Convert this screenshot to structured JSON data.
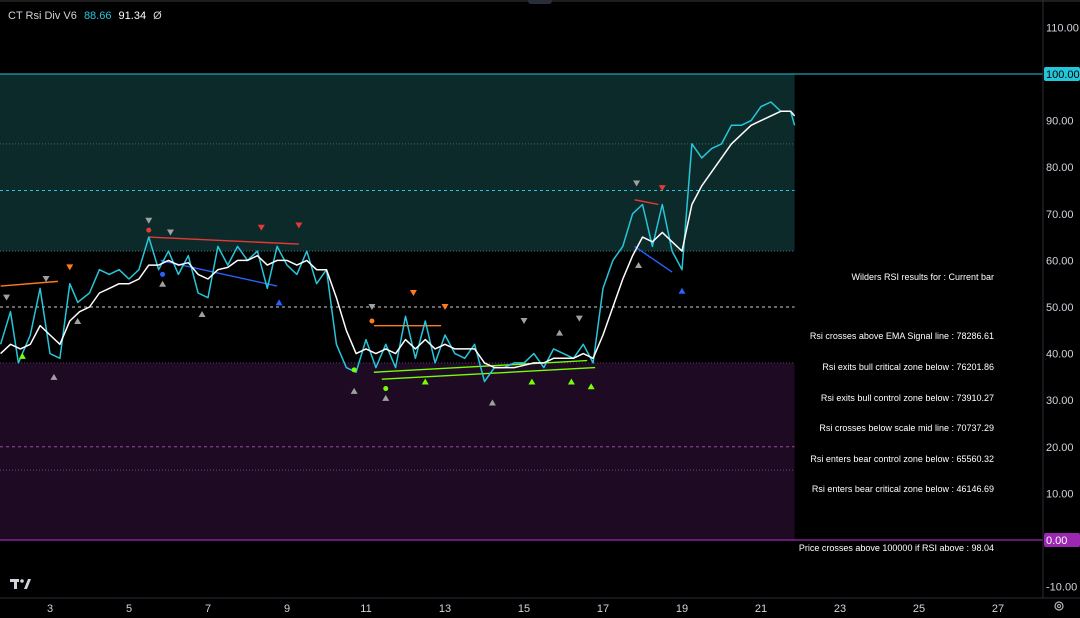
{
  "indicator": {
    "name": "CT Rsi Div V6",
    "value_rsi": "88.66",
    "value_signal": "91.34",
    "symbol": "Ø"
  },
  "results": {
    "title": "Wilders RSI results for : Current bar",
    "lines": [
      "Rsi crosses above EMA Signal line : 78286.61",
      "Rsi exits bull critical zone below : 76201.86",
      "Rsi exits bull control zone below : 73910.27",
      "Rsi crosses below scale mid line : 70737.29",
      "Rsi enters bear control zone below : 65560.32",
      "Rsi enters bear critical zone below : 46146.69"
    ],
    "price_line": "Price crosses above 100000 if RSI above : 98.04"
  },
  "colors": {
    "rsi": "#26c6da",
    "signal": "#ffffff",
    "bull_zone": "#0d2a2a",
    "bear_zone": "#1e0a22",
    "bull_div": "#e53935",
    "bear_div": "#2962ff",
    "hidden_bull": "#76ff03",
    "hidden_bear": "#ff7a1a",
    "marker_gray": "#a0a0a0",
    "line_0": "#9c27b0",
    "line_100": "#26c6da"
  },
  "icons": {
    "logo": "tradingview-logo-icon",
    "settings": "gear-icon"
  },
  "chart_data": {
    "type": "line",
    "ylim": [
      -12,
      113
    ],
    "xlim": [
      1.7,
      28
    ],
    "y_ticks": [
      "110.00",
      "100.00",
      "90.00",
      "80.00",
      "70.00",
      "60.00",
      "50.00",
      "40.00",
      "30.00",
      "20.00",
      "10.00",
      "0.00",
      "-10.00"
    ],
    "y_tick_values": [
      110,
      100,
      90,
      80,
      70,
      60,
      50,
      40,
      30,
      20,
      10,
      0,
      -10
    ],
    "x_ticks": [
      "3",
      "5",
      "7",
      "9",
      "11",
      "13",
      "15",
      "17",
      "19",
      "21",
      "23",
      "25",
      "27"
    ],
    "x_tick_values": [
      3,
      5,
      7,
      9,
      11,
      13,
      15,
      17,
      19,
      21,
      23,
      25,
      27
    ],
    "levels": [
      100,
      85,
      75,
      62,
      50,
      38,
      20,
      15,
      0
    ],
    "bull_zone": [
      62,
      100
    ],
    "bear_zone": [
      0,
      38
    ],
    "zone_end_x": 21.85,
    "series": [
      {
        "x": [
          1.75,
          2.0,
          2.2,
          2.5,
          2.75,
          3.0,
          3.25,
          3.5,
          3.7,
          4.0,
          4.25,
          4.5,
          4.75,
          5.0,
          5.25,
          5.5,
          5.75,
          6.0,
          6.25,
          6.5,
          6.75,
          7.0,
          7.25,
          7.5,
          7.75,
          8.0,
          8.25,
          8.5,
          8.75,
          9.0,
          9.25,
          9.5,
          9.75,
          10.0,
          10.25,
          10.5,
          10.75,
          11.0,
          11.25,
          11.5,
          11.75,
          12.0,
          12.25,
          12.5,
          12.75,
          13.0,
          13.25,
          13.5,
          13.75,
          14.0,
          14.25,
          14.5,
          14.75,
          15.0,
          15.25,
          15.5,
          15.75,
          16.0,
          16.25,
          16.5,
          16.75,
          17.0,
          17.25,
          17.5,
          17.75,
          18.0,
          18.25,
          18.5,
          18.75,
          19.0,
          19.25,
          19.5,
          19.75,
          20.0,
          20.25,
          20.5,
          20.75,
          21.0,
          21.25,
          21.5,
          21.75,
          21.85
        ],
        "y": [
          42,
          49,
          38,
          44,
          54,
          40,
          39,
          55,
          51,
          53,
          58,
          57,
          58,
          56,
          58,
          65,
          58,
          62,
          57,
          61,
          53,
          52,
          63,
          59,
          63,
          60,
          62,
          54,
          63,
          59,
          57,
          62,
          55,
          58,
          42,
          37,
          36,
          43,
          37,
          42,
          37,
          48,
          39,
          47,
          38,
          44,
          40,
          39,
          42,
          34,
          37,
          37,
          38,
          38,
          40,
          37,
          41,
          40,
          39,
          42,
          38,
          54,
          60,
          63,
          70,
          72,
          63,
          72,
          62,
          58,
          85,
          82,
          84,
          85,
          89,
          89,
          90,
          93,
          94,
          92,
          92,
          89
        ]
      },
      {
        "x": [
          1.75,
          2.0,
          2.25,
          2.5,
          2.75,
          3.0,
          3.25,
          3.5,
          3.75,
          4.0,
          4.25,
          4.5,
          4.75,
          5.0,
          5.25,
          5.5,
          5.75,
          6.0,
          6.25,
          6.5,
          6.75,
          7.0,
          7.25,
          7.5,
          7.75,
          8.0,
          8.25,
          8.5,
          8.75,
          9.0,
          9.25,
          9.5,
          9.75,
          10.0,
          10.25,
          10.5,
          10.75,
          11.0,
          11.25,
          11.5,
          11.75,
          12.0,
          12.25,
          12.5,
          12.75,
          13.0,
          13.25,
          13.5,
          13.75,
          14.0,
          14.25,
          14.5,
          14.75,
          15.0,
          15.25,
          15.5,
          15.75,
          16.0,
          16.25,
          16.5,
          16.75,
          17.0,
          17.25,
          17.5,
          17.75,
          18.0,
          18.25,
          18.5,
          18.75,
          19.0,
          19.25,
          19.5,
          19.75,
          20.0,
          20.25,
          20.5,
          20.75,
          21.0,
          21.25,
          21.5,
          21.75,
          21.85
        ],
        "y": [
          40,
          42,
          41,
          42,
          46,
          44,
          42,
          47,
          49,
          50,
          53,
          54,
          55,
          55,
          56,
          59,
          59,
          60,
          59,
          59.5,
          57,
          56,
          58,
          58.5,
          60,
          60,
          61,
          59,
          60,
          60,
          59,
          60,
          58,
          58,
          52,
          45,
          40,
          41,
          40,
          41,
          40,
          43,
          41,
          43,
          41,
          42,
          41,
          41,
          41,
          38,
          37,
          37,
          37,
          37.5,
          38,
          38,
          39,
          39,
          39,
          40,
          39,
          44,
          50,
          56,
          61,
          65,
          64,
          66,
          64,
          62,
          72,
          76,
          79,
          82,
          85,
          87,
          89,
          90,
          91,
          92,
          92,
          91
        ]
      }
    ]
  }
}
